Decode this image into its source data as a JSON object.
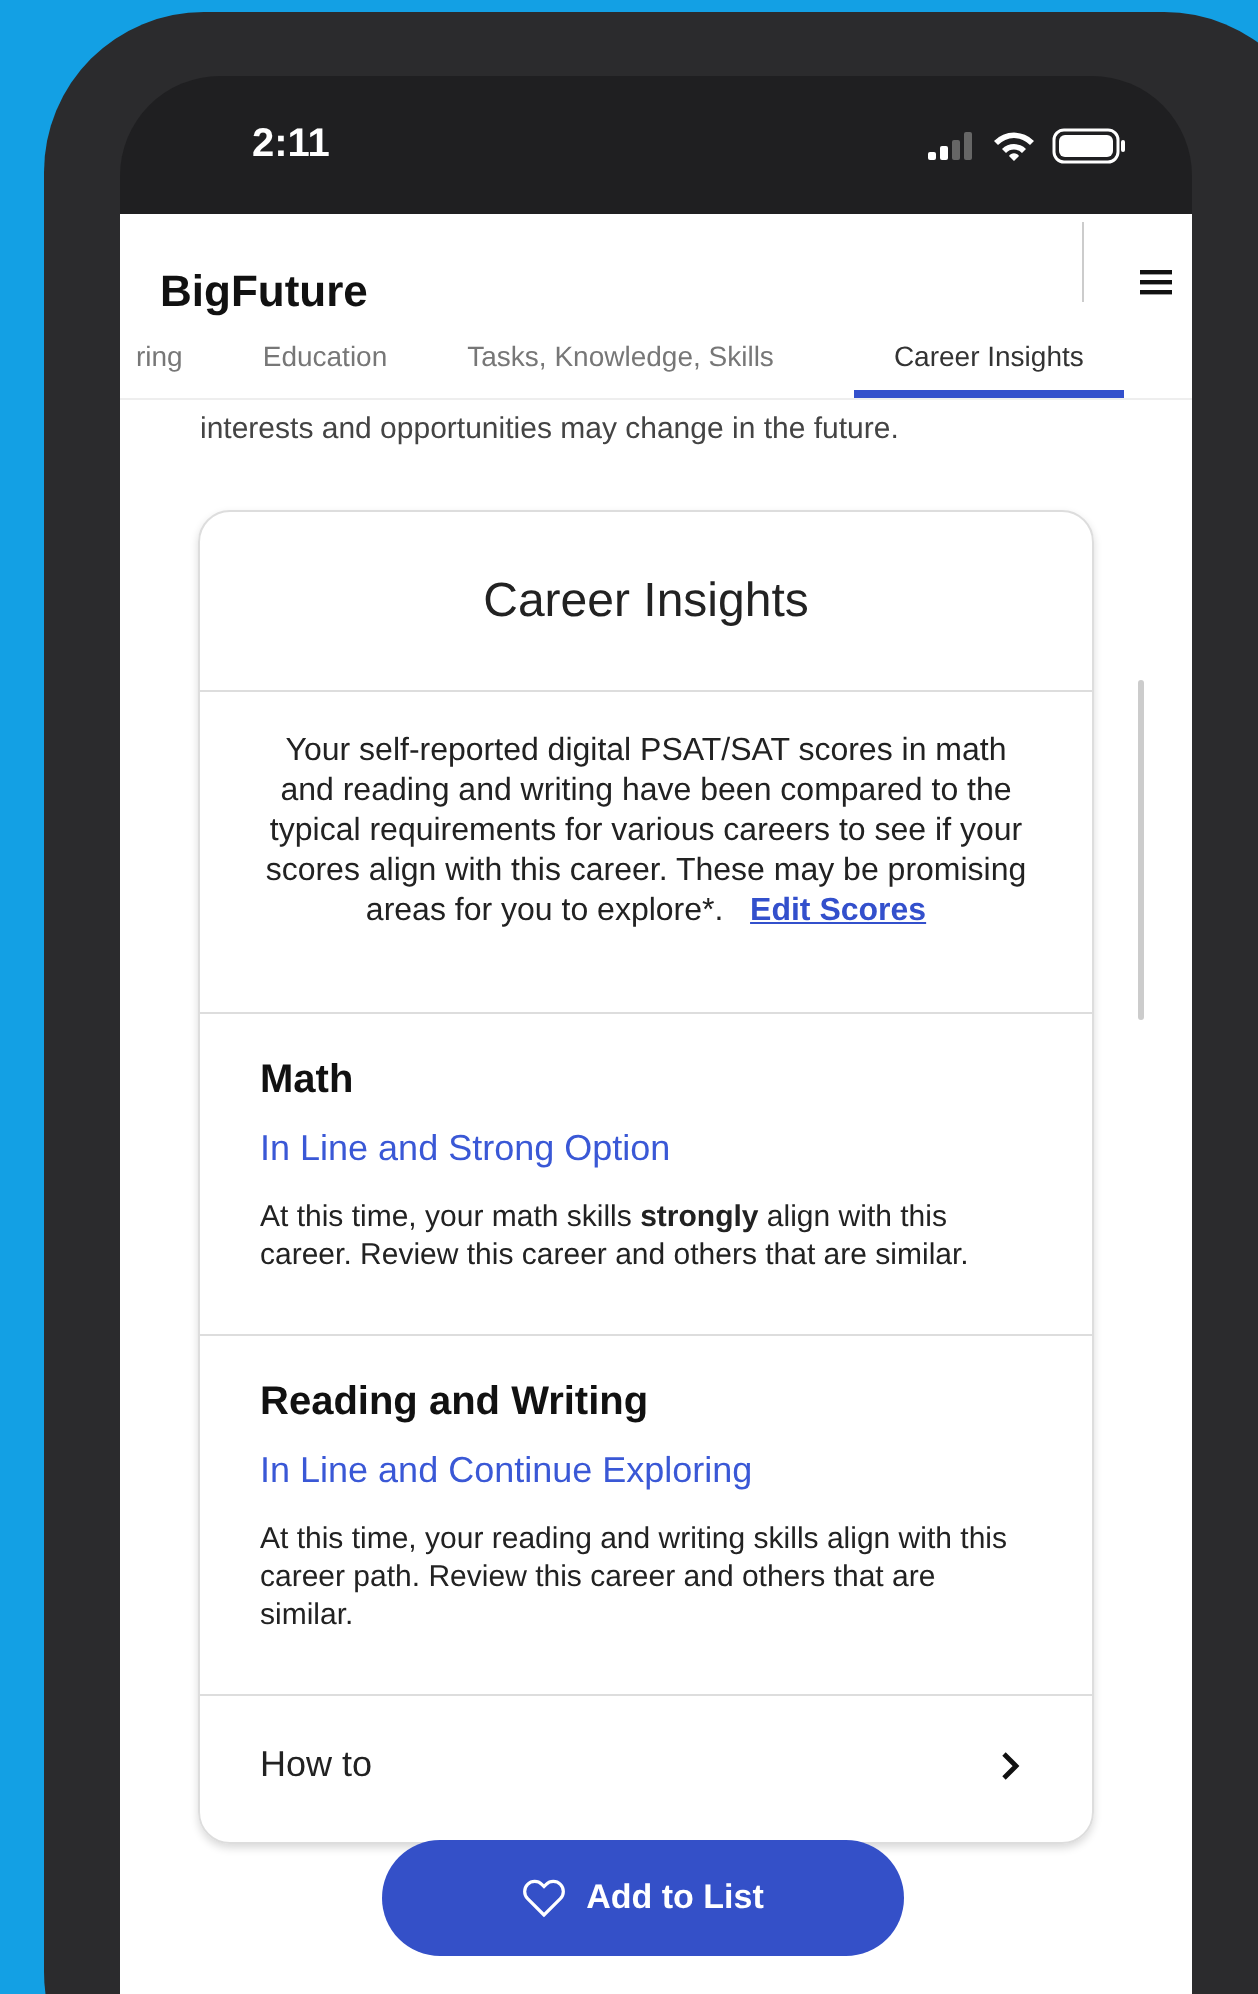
{
  "status_bar": {
    "time": "2:11"
  },
  "header": {
    "logo": "BigFuture"
  },
  "tabs": [
    {
      "label": "ring",
      "selected": false
    },
    {
      "label": "Education",
      "selected": false
    },
    {
      "label": "Tasks, Knowledge, Skills",
      "selected": false
    },
    {
      "label": "Career Insights",
      "selected": true
    }
  ],
  "intro_text": "interests and opportunities may change in the future.",
  "card": {
    "title": "Career Insights",
    "description": "Your self-reported digital PSAT/SAT scores in math and reading and writing have been compared to the typical requirements for various careers to see if your scores align with this career. These may be promising areas for you to explore*.",
    "link": "Edit Scores",
    "sections": [
      {
        "title": "Math",
        "status": "In Line and Strong Option",
        "text": "At this time, your math skills **strongly** align with this career. Review this career and others that are similar."
      },
      {
        "title": "Reading and Writing",
        "status": "In Line and Continue Exploring",
        "text": "At this time, your reading and writing skills align with this career path. Review this career and others that are similar."
      }
    ],
    "footer_row": "How to"
  },
  "floating_button": {
    "label": "Add to List"
  }
}
